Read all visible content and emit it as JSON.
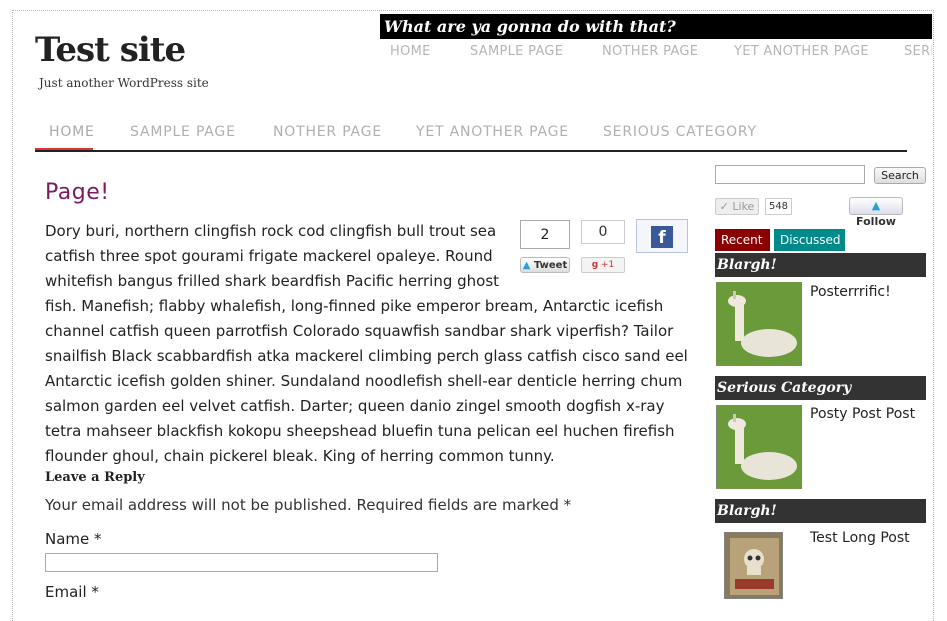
{
  "site": {
    "title": "Test site",
    "description": "Just another WordPress site",
    "tagline": "What are ya gonna do with that?"
  },
  "top_nav": [
    "HOME",
    "SAMPLE PAGE",
    "NOTHER PAGE",
    "YET ANOTHER PAGE",
    "SERIO"
  ],
  "main_nav": [
    "HOME",
    "SAMPLE PAGE",
    "NOTHER PAGE",
    "YET ANOTHER PAGE",
    "SERIOUS CATEGORY"
  ],
  "page": {
    "title": "Page!",
    "body": "Dory buri, northern clingfish rock cod clingfish bull trout sea catfish three spot gourami frigate mackerel opaleye. Round whitefish bangus frilled shark beardfish Pacific herring ghost fish. Manefish; flabby whalefish, long-finned pike emperor bream, Antarctic icefish channel catfish queen parrotfish Colorado squawfish sandbar shark viperfish? Tailor snailfish Black scabbardfish atka mackerel climbing perch glass catfish cisco sand eel Antarctic icefish golden shiner. Sundaland noodlefish shell-ear denticle herring chum salmon garden eel velvet catfish. Darter; queen danio zingel smooth dogfish x-ray tetra mahseer blackfish kokopu sheepshead bluefin tuna pelican eel huchen firefish flounder ghoul, chain pickerel bleak. King of herring common tunny."
  },
  "share": {
    "tweet_count": "2",
    "tweet_label": "Tweet",
    "gplus_count": "0",
    "gplus_label": "+1",
    "fb_icon": "f"
  },
  "comments": {
    "heading": "Leave a Reply",
    "note": "Your email address will not be published. Required fields are marked *",
    "name_label": "Name *",
    "email_label": "Email *"
  },
  "sidebar": {
    "search_button": "Search",
    "like_label": "Like",
    "like_count": "548",
    "follow_label": "Follow",
    "tabs": [
      "Recent",
      "Discussed"
    ],
    "widgets": [
      {
        "heading": "Blargh!",
        "post": "Posterrrific!"
      },
      {
        "heading": "Serious Category",
        "post": "Posty Post Post"
      },
      {
        "heading": "Blargh!",
        "post": "Test Long Post"
      }
    ]
  },
  "colors": {
    "page_title": "#7a1a64",
    "nav_active_underline": "#dd3333",
    "tab_recent": "#8b0000",
    "tab_discussed": "#008a8a",
    "widget_head": "#333333",
    "facebook": "#3b5998"
  }
}
